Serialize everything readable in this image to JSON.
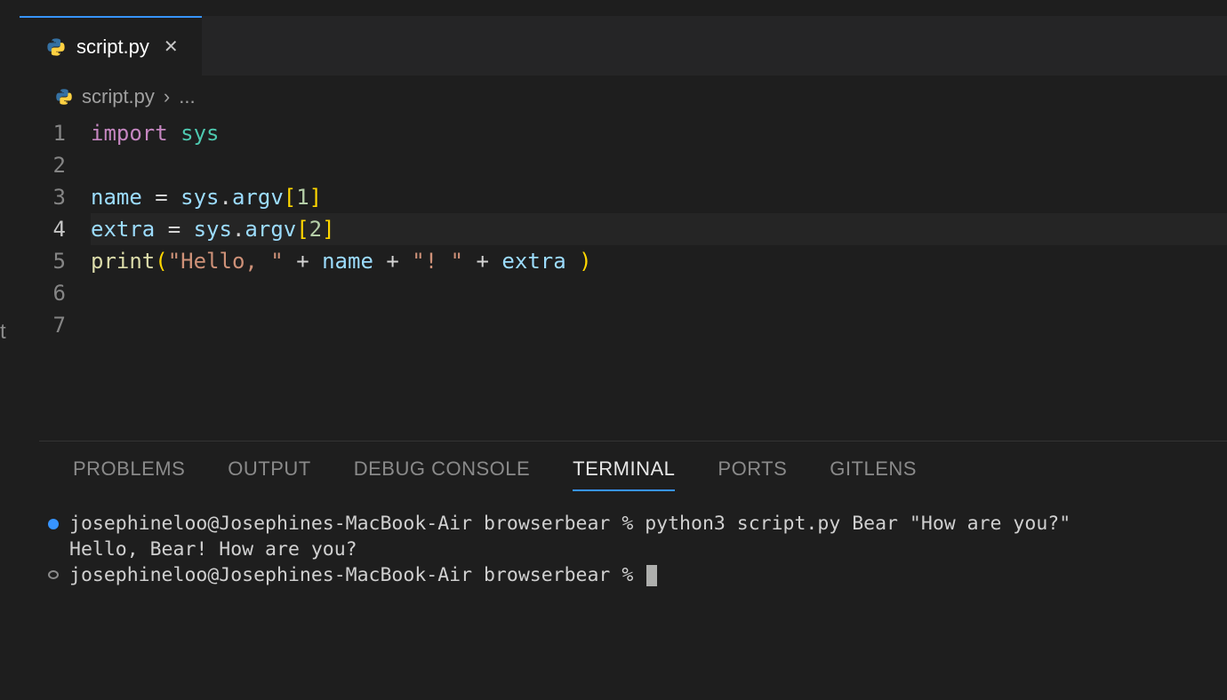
{
  "tab": {
    "filename": "script.py",
    "icon": "python-icon"
  },
  "breadcrumb": {
    "filename": "script.py",
    "extra": "..."
  },
  "clip_label": "t",
  "code": {
    "line_numbers": [
      "1",
      "2",
      "3",
      "4",
      "5",
      "6",
      "7"
    ],
    "active_line": 4,
    "lines": [
      {
        "tokens": [
          {
            "t": "import",
            "c": "kw"
          },
          {
            "t": " ",
            "c": "op"
          },
          {
            "t": "sys",
            "c": "mod"
          }
        ]
      },
      {
        "tokens": []
      },
      {
        "tokens": [
          {
            "t": "name",
            "c": "var"
          },
          {
            "t": " ",
            "c": "op"
          },
          {
            "t": "=",
            "c": "op"
          },
          {
            "t": " ",
            "c": "op"
          },
          {
            "t": "sys",
            "c": "obj"
          },
          {
            "t": ".",
            "c": "op"
          },
          {
            "t": "argv",
            "c": "prop"
          },
          {
            "t": "[",
            "c": "brkt"
          },
          {
            "t": "1",
            "c": "num"
          },
          {
            "t": "]",
            "c": "brkt"
          }
        ]
      },
      {
        "tokens": [
          {
            "t": "extra",
            "c": "var"
          },
          {
            "t": " ",
            "c": "op"
          },
          {
            "t": "=",
            "c": "op"
          },
          {
            "t": " ",
            "c": "op"
          },
          {
            "t": "sys",
            "c": "obj"
          },
          {
            "t": ".",
            "c": "op"
          },
          {
            "t": "argv",
            "c": "prop"
          },
          {
            "t": "[",
            "c": "brkt"
          },
          {
            "t": "2",
            "c": "num"
          },
          {
            "t": "]",
            "c": "brkt"
          }
        ]
      },
      {
        "tokens": [
          {
            "t": "print",
            "c": "fn"
          },
          {
            "t": "(",
            "c": "par"
          },
          {
            "t": "\"Hello, \"",
            "c": "str"
          },
          {
            "t": " ",
            "c": "op"
          },
          {
            "t": "+",
            "c": "op"
          },
          {
            "t": " ",
            "c": "op"
          },
          {
            "t": "name",
            "c": "var"
          },
          {
            "t": " ",
            "c": "op"
          },
          {
            "t": "+",
            "c": "op"
          },
          {
            "t": " ",
            "c": "op"
          },
          {
            "t": "\"! \"",
            "c": "str"
          },
          {
            "t": " ",
            "c": "op"
          },
          {
            "t": "+",
            "c": "op"
          },
          {
            "t": " ",
            "c": "op"
          },
          {
            "t": "extra",
            "c": "var"
          },
          {
            "t": " ",
            "c": "op"
          },
          {
            "t": ")",
            "c": "par"
          }
        ]
      },
      {
        "tokens": []
      },
      {
        "tokens": []
      }
    ]
  },
  "panel": {
    "tabs": {
      "problems": "PROBLEMS",
      "output": "OUTPUT",
      "debug": "DEBUG CONSOLE",
      "terminal": "TERMINAL",
      "ports": "PORTS",
      "gitlens": "GITLENS"
    },
    "active": "terminal"
  },
  "terminal": {
    "prompt": "josephineloo@Josephines-MacBook-Air browserbear % ",
    "command": "python3 script.py Bear \"How are you?\"",
    "output": "Hello, Bear! How are you?"
  }
}
